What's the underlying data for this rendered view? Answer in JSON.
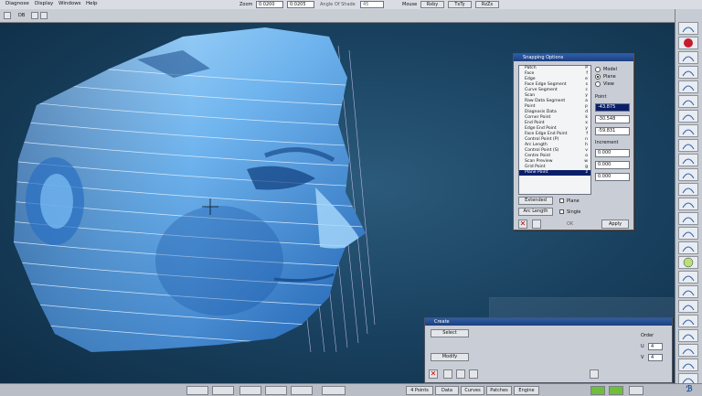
{
  "menubar": {
    "menus": [
      "Diagnose",
      "Display",
      "Windows",
      "Help"
    ],
    "zoom_label": "Zoom",
    "zoom_value": "0.0200",
    "zoom_value2": "0.0205",
    "angle_label": "Angle Of Shade",
    "angle_value": "45",
    "mouse_label": "Mouse",
    "mouse_buttons": [
      "Rxby",
      "TxTy",
      "RzZs"
    ]
  },
  "toolbar2": {
    "file_label": "DB"
  },
  "snap_panel": {
    "title": "Snapping Options",
    "items": [
      {
        "label": "Patch",
        "key": "P"
      },
      {
        "label": "Face",
        "key": "f"
      },
      {
        "label": "Edge",
        "key": "e"
      },
      {
        "label": "Face Edge Segment",
        "key": "s"
      },
      {
        "label": "Curve Segment",
        "key": "c"
      },
      {
        "label": "Scan",
        "key": "y"
      },
      {
        "label": "Raw Data Segment",
        "key": "a"
      },
      {
        "label": "Point",
        "key": "p"
      },
      {
        "label": "Diagnosis Data",
        "key": "d"
      },
      {
        "label": "Corner Point",
        "key": "k"
      },
      {
        "label": "End Point",
        "key": "x"
      },
      {
        "label": "Edge End Point",
        "key": "y"
      },
      {
        "label": "Face Edge End Point",
        "key": "f"
      },
      {
        "label": "Control Point (P)",
        "key": "n"
      },
      {
        "label": "Arc Length",
        "key": "h"
      },
      {
        "label": "Control Point (S)",
        "key": "v"
      },
      {
        "label": "Centre Point",
        "key": "o"
      },
      {
        "label": "Scan Preview",
        "key": "w"
      },
      {
        "label": "Grid Point",
        "key": "g"
      },
      {
        "label": "Plane Point",
        "key": "z"
      }
    ],
    "selected_index": 19,
    "modes": [
      "Model",
      "Plane",
      "View"
    ],
    "point_label": "Point",
    "point_values": [
      "-43.875",
      "-30.548",
      "-59.831"
    ],
    "increment_label": "Increment",
    "increment_values": [
      "0.000",
      "0.000",
      "0.000"
    ],
    "extended_label": "Extended",
    "arc_length_label": "Arc Length",
    "plane_label": "Plane",
    "single_label": "Single",
    "ok_label": "OK",
    "apply_label": "Apply"
  },
  "create_panel": {
    "title": "Create",
    "select_label": "Select",
    "modify_label": "Modify",
    "order_label": "Order",
    "u_label": "U",
    "v_label": "V",
    "u_value": "4",
    "v_value": "4"
  },
  "bottombar": {
    "buttons": [
      "4 Points",
      "Data",
      "Curves",
      "Patches",
      "Engine"
    ]
  }
}
